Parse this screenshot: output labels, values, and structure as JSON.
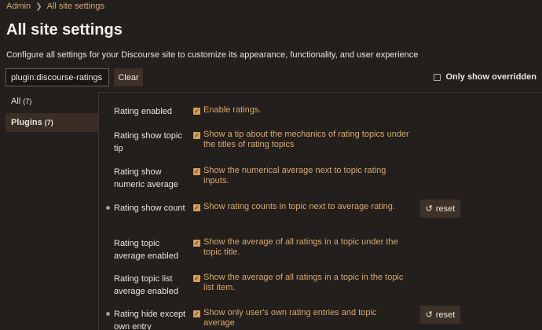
{
  "breadcrumb": {
    "parent": "Admin",
    "current": "All site settings"
  },
  "title": "All site settings",
  "description": "Configure all settings for your Discourse site to customize its appearance, functionality, and user experience",
  "filter": {
    "value": "plugin:discourse-ratings",
    "clear_label": "Clear",
    "only_overridden_label": "Only show overridden",
    "only_overridden_checked": false
  },
  "sidebar": {
    "items": [
      {
        "label": "All",
        "count": "(7)",
        "active": false
      },
      {
        "label": "Plugins",
        "count": "(7)",
        "active": true
      }
    ]
  },
  "settings": [
    {
      "name": "Rating enabled",
      "description": "Enable ratings.",
      "checked": true,
      "overridden": false
    },
    {
      "name": "Rating show topic tip",
      "description": "Show a tip about the mechanics of rating topics under the titles of rating topics",
      "checked": true,
      "overridden": false
    },
    {
      "name": "Rating show numeric average",
      "description": "Show the numerical average next to topic rating inputs.",
      "checked": true,
      "overridden": false
    },
    {
      "name": "Rating show count",
      "description": "Show rating counts in topic next to average rating.",
      "checked": true,
      "overridden": true,
      "reset_label": "reset"
    },
    {
      "name": "Rating topic average enabled",
      "description": "Show the average of all ratings in a topic under the topic title.",
      "checked": true,
      "overridden": false
    },
    {
      "name": "Rating topic list average enabled",
      "description": "Show the average of all ratings in a topic in the topic list item.",
      "checked": true,
      "overridden": false
    },
    {
      "name": "Rating hide except own entry",
      "description": "Show only user's own rating entries and topic average",
      "checked": true,
      "overridden": true,
      "reset_label": "reset"
    }
  ],
  "colors": {
    "background": "#231f1c",
    "accent": "#d99c55",
    "link": "#d9a86a",
    "button": "#3d3128"
  }
}
